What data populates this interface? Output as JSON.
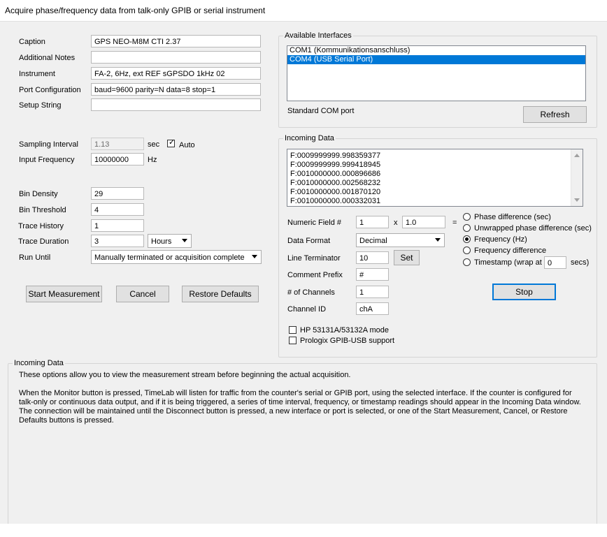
{
  "window": {
    "title": "Acquire phase/frequency data from talk-only GPIB or serial instrument"
  },
  "form": {
    "caption": {
      "label": "Caption",
      "value": "GPS NEO-M8M  CTI 2.37"
    },
    "notes": {
      "label": "Additional Notes",
      "value": ""
    },
    "instrument": {
      "label": "Instrument",
      "value": "FA-2, 6Hz, ext REF sGPSDO 1kHz 02"
    },
    "port_config": {
      "label": "Port Configuration",
      "value": "baud=9600 parity=N data=8 stop=1"
    },
    "setup_string": {
      "label": "Setup String",
      "value": ""
    },
    "sampling_interval": {
      "label": "Sampling Interval",
      "value": "1.13",
      "unit": "sec",
      "auto_label": "Auto",
      "auto_checked": true
    },
    "input_frequency": {
      "label": "Input Frequency",
      "value": "10000000",
      "unit": "Hz"
    },
    "bin_density": {
      "label": "Bin Density",
      "value": "29"
    },
    "bin_threshold": {
      "label": "Bin Threshold",
      "value": "4"
    },
    "trace_history": {
      "label": "Trace History",
      "value": "1"
    },
    "trace_duration": {
      "label": "Trace Duration",
      "value": "3",
      "unit": "Hours"
    },
    "run_until": {
      "label": "Run Until",
      "value": "Manually terminated or acquisition complete"
    }
  },
  "buttons": {
    "start": "Start Measurement",
    "cancel": "Cancel",
    "restore": "Restore Defaults",
    "refresh": "Refresh",
    "set": "Set",
    "stop": "Stop"
  },
  "interfaces": {
    "title": "Available Interfaces",
    "items": [
      "COM1 (Kommunikationsanschluss)",
      "COM4 (USB Serial Port)"
    ],
    "selected_index": 1,
    "description": "Standard COM port"
  },
  "incoming": {
    "title": "Incoming Data",
    "lines": [
      "F:0009999999.998359377",
      "F:0009999999.999418945",
      "F:0010000000.000896686",
      "F:0010000000.002568232",
      "F:0010000000.001870120",
      "F:0010000000.000332031"
    ],
    "numeric_field": {
      "label": "Numeric Field #",
      "value": "1",
      "times": "x",
      "scale": "1.0",
      "equals": "="
    },
    "data_format": {
      "label": "Data Format",
      "value": "Decimal"
    },
    "line_terminator": {
      "label": "Line Terminator",
      "value": "10"
    },
    "comment_prefix": {
      "label": "Comment Prefix",
      "value": "#"
    },
    "channels": {
      "label": "# of Channels",
      "value": "1"
    },
    "channel_id": {
      "label": "Channel ID",
      "value": "chA"
    },
    "modes": [
      "Phase difference (sec)",
      "Unwrapped phase difference (sec)",
      "Frequency (Hz)",
      "Frequency difference",
      "Timestamp (wrap at"
    ],
    "selected_mode": 2,
    "wrap_value": "0",
    "wrap_unit": "secs)",
    "hp_mode": {
      "label": "HP 53131A/53132A mode",
      "checked": false
    },
    "prologix": {
      "label": "Prologix GPIB-USB support",
      "checked": false
    }
  },
  "info": {
    "title": "Incoming Data",
    "p1": "These options allow you to view the measurement stream before beginning the actual acquisition.",
    "p2_lines": [
      "When the Monitor button is pressed, TimeLab will listen for traffic from the counter's serial or GPIB port, using the selected interface.  If the counter is configured for",
      "talk-only or continuous data output, and if it is being triggered, a series of time interval, frequency, or timestamp readings should appear in the Incoming Data window.",
      "The connection will be maintained until the Disconnect button is pressed, a new interface or port is selected, or one of the Start Measurement, Cancel, or Restore",
      "Defaults buttons is pressed."
    ]
  },
  "colors": {
    "accent": "#0078d7",
    "face": "#f0f0f0"
  }
}
